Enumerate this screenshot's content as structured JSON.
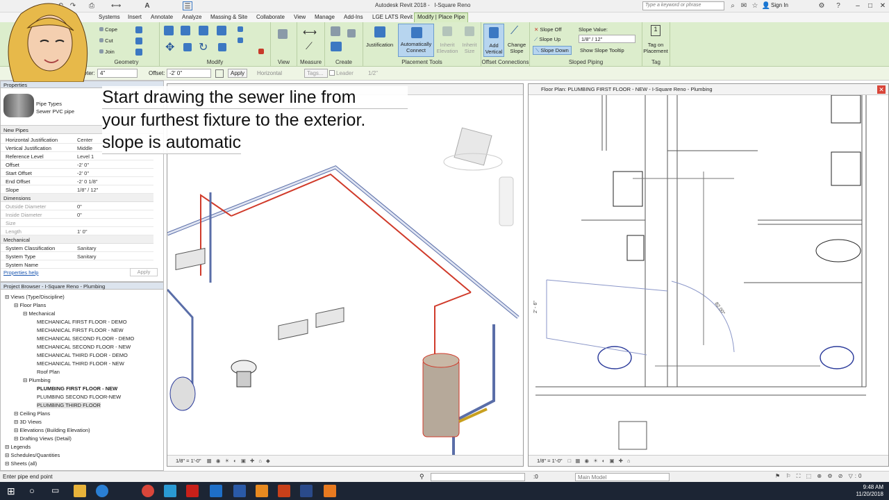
{
  "app": {
    "title": "Autodesk Revit 2018 -",
    "project": "I-Square Reno",
    "search_placeholder": "Type a keyword or phrase",
    "sign_in": "Sign In"
  },
  "menu": [
    "Systems",
    "Insert",
    "Annotate",
    "Analyze",
    "Massing & Site",
    "Collaborate",
    "View",
    "Manage",
    "Add-Ins",
    "LGE LATS Revit",
    "Modify | Place Pipe"
  ],
  "ribbon": {
    "geometry": {
      "label": "Geometry",
      "cope": "Cope",
      "cut": "Cut",
      "join": "Join"
    },
    "modify": {
      "label": "Modify"
    },
    "view": {
      "label": "View"
    },
    "measure": {
      "label": "Measure"
    },
    "create": {
      "label": "Create"
    },
    "placement": {
      "label": "Placement Tools",
      "justification": "Justification",
      "auto_connect": "Automatically Connect",
      "inherit_elevation": "Inherit Elevation",
      "inherit_size": "Inherit Size"
    },
    "offset": {
      "label": "Offset Connections",
      "add_vertical": "Add Vertical",
      "change_slope": "Change Slope"
    },
    "sloped": {
      "label": "Sloped Piping",
      "slope_off": "Slope Off",
      "slope_up": "Slope Up",
      "slope_down": "Slope Down",
      "slope_value_label": "Slope Value:",
      "slope_value": "1/8\" / 12\"",
      "show_tooltip": "Show Slope Tooltip"
    },
    "tag": {
      "label": "Tag",
      "tag_on_placement": "Tag on Placement"
    }
  },
  "options": {
    "diameter_label": "Diameter:",
    "diameter": "4\"",
    "offset_label": "Offset:",
    "offset": "-2' 0\"",
    "apply": "Apply",
    "horizontal": "Horizontal",
    "tags": "Tags...",
    "leader": "Leader",
    "leader_len": "1/2\""
  },
  "properties": {
    "title": "Properties",
    "type_family": "Pipe Types",
    "type_name": "Sewer PVC pipe",
    "new_label": "New Pipes",
    "rows": [
      {
        "k": "Horizontal Justification",
        "v": "Center"
      },
      {
        "k": "Vertical Justification",
        "v": "Middle"
      },
      {
        "k": "Reference Level",
        "v": "Level 1"
      },
      {
        "k": "Offset",
        "v": "-2' 0\""
      },
      {
        "k": "Start Offset",
        "v": "-2' 0\""
      },
      {
        "k": "End Offset",
        "v": "-2' 0 1/8\""
      },
      {
        "k": "Slope",
        "v": "1/8\" / 12\""
      }
    ],
    "dimensions_label": "Dimensions",
    "dim_rows": [
      {
        "k": "Outside Diameter",
        "v": "0\""
      },
      {
        "k": "Inside Diameter",
        "v": "0\""
      },
      {
        "k": "Size",
        "v": ""
      },
      {
        "k": "Length",
        "v": "1' 0\""
      }
    ],
    "mechanical_label": "Mechanical",
    "mech_rows": [
      {
        "k": "System Classification",
        "v": "Sanitary"
      },
      {
        "k": "System Type",
        "v": "Sanitary"
      },
      {
        "k": "System Name",
        "v": ""
      }
    ],
    "help": "Properties help",
    "apply": "Apply"
  },
  "browser": {
    "title": "Project Browser - I-Square Reno - Plumbing",
    "items": [
      {
        "t": "Views (Type/Discipline)",
        "lvl": 0
      },
      {
        "t": "Floor Plans",
        "lvl": 1
      },
      {
        "t": "Mechanical",
        "lvl": 2
      },
      {
        "t": "MECHANICAL FIRST FLOOR - DEMO",
        "lvl": 3
      },
      {
        "t": "MECHANICAL FIRST FLOOR - NEW",
        "lvl": 3
      },
      {
        "t": "MECHANICAL SECOND FLOOR - DEMO",
        "lvl": 3
      },
      {
        "t": "MECHANICAL SECOND FLOOR - NEW",
        "lvl": 3
      },
      {
        "t": "MECHANICAL THIRD FLOOR - DEMO",
        "lvl": 3
      },
      {
        "t": "MECHANICAL THIRD FLOOR - NEW",
        "lvl": 3
      },
      {
        "t": "Roof Plan",
        "lvl": 3
      },
      {
        "t": "Plumbing",
        "lvl": 2
      },
      {
        "t": "PLUMBING FIRST FLOOR - NEW",
        "lvl": 3
      },
      {
        "t": "PLUMBING SECOND FLOOR-NEW",
        "lvl": 3
      },
      {
        "t": "PLUMBING THIRD FLOOR",
        "lvl": 3
      },
      {
        "t": "Ceiling Plans",
        "lvl": 1
      },
      {
        "t": "3D Views",
        "lvl": 1
      },
      {
        "t": "Elevations (Building Elevation)",
        "lvl": 1
      },
      {
        "t": "Drafting Views (Detail)",
        "lvl": 1
      },
      {
        "t": "Legends",
        "lvl": 0
      },
      {
        "t": "Schedules/Quantities",
        "lvl": 0
      },
      {
        "t": "Sheets (all)",
        "lvl": 0
      }
    ]
  },
  "callout": {
    "lines": [
      "Start drawing the sewer line from",
      "your furthest fixture to the exterior.",
      "slope is automatic"
    ]
  },
  "view3d": {
    "scale": "1/8\" = 1'-0\""
  },
  "viewfp": {
    "title": "Floor Plan: PLUMBING FIRST FLOOR - NEW - I-Square Reno - Plumbing",
    "scale": "1/8\" = 1'-0\"",
    "dim_text": "82.00°",
    "dim_side": "2' - 6\""
  },
  "status": {
    "text": "Enter pipe end point",
    "zero": ":0",
    "model": "Main Model"
  },
  "clock": {
    "time": "9:48 AM",
    "date": "11/20/2018"
  }
}
